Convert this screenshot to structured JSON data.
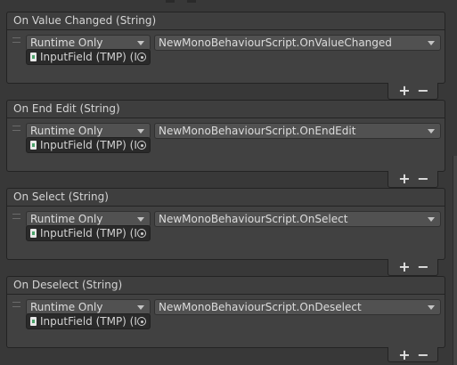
{
  "events": [
    {
      "title": "On Value Changed (String)",
      "runtime": "Runtime Only",
      "function": "NewMonoBehaviourScript.OnValueChanged",
      "target": "InputField (TMP) (I"
    },
    {
      "title": "On End Edit (String)",
      "runtime": "Runtime Only",
      "function": "NewMonoBehaviourScript.OnEndEdit",
      "target": "InputField (TMP) (I"
    },
    {
      "title": "On Select (String)",
      "runtime": "Runtime Only",
      "function": "NewMonoBehaviourScript.OnSelect",
      "target": "InputField (TMP) (I"
    },
    {
      "title": "On Deselect (String)",
      "runtime": "Runtime Only",
      "function": "NewMonoBehaviourScript.OnDeselect",
      "target": "InputField (TMP) (I"
    }
  ],
  "controls": {
    "add_label": "+",
    "remove_label": "−"
  },
  "icons": {
    "object_icon": "tmp-inputfield-icon",
    "picker_icon": "object-picker-icon",
    "handle_icon": "drag-handle-icon",
    "dropdown_icon": "chevron-down-icon"
  },
  "colors": {
    "background": "#383838",
    "header": "#3e3e3e",
    "body": "#414141",
    "field": "#515151",
    "object_field": "#2a2a2a",
    "text": "#d2d2d2"
  }
}
